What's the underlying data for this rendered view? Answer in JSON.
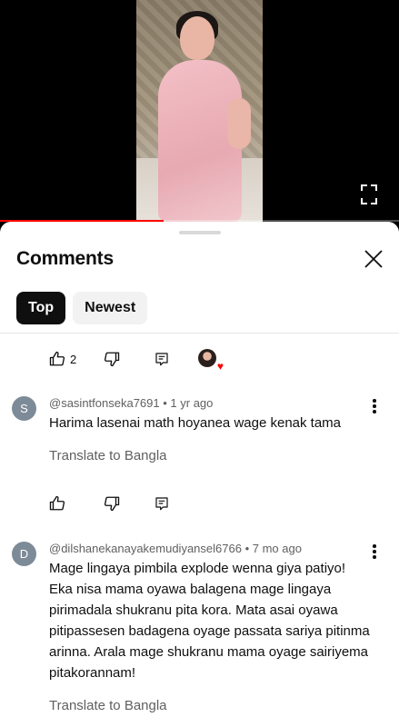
{
  "video": {
    "progress_fraction": 0.41
  },
  "sheet": {
    "title": "Comments",
    "chips": [
      {
        "label": "Top",
        "active": true
      },
      {
        "label": "Newest",
        "active": false
      }
    ]
  },
  "top_actions": {
    "like_count": "2"
  },
  "comments": [
    {
      "avatar_letter": "S",
      "avatar_color": "#7d8a97",
      "author": "@sasintfonseka7691",
      "time": "1 yr ago",
      "text": "Harima lasenai math hoyanea wage kenak tama",
      "translate": "Translate to Bangla",
      "like_count": ""
    },
    {
      "avatar_letter": "D",
      "avatar_color": "#7d8a97",
      "author": "@dilshanekanayakemudiyansel6766",
      "time": "7 mo ago",
      "text": "Mage lingaya pimbila explode wenna giya patiyo! Eka nisa mama oyawa balagena mage lingaya pirimadala shukranu pita kora. Mata asai oyawa pitipassesen badagena oyage passata sariya pitinma arinna. Arala mage shukranu mama oyage sairiyema pitakorannam!",
      "translate": "Translate to Bangla"
    }
  ],
  "icons": {
    "like": "thumbs-up-icon",
    "dislike": "thumbs-down-icon",
    "reply": "reply-icon",
    "more": "more-vert-icon",
    "close": "close-icon",
    "fullscreen": "fullscreen-icon"
  }
}
